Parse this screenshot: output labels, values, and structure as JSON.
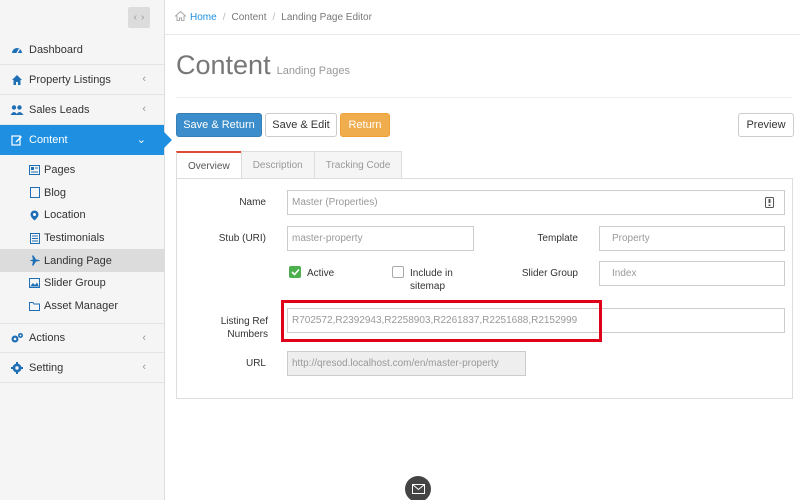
{
  "sidebar": {
    "nav": [
      {
        "label": "Dashboard",
        "icon": "dashboard-icon"
      },
      {
        "label": "Property Listings",
        "icon": "home-icon"
      },
      {
        "label": "Sales Leads",
        "icon": "users-icon"
      },
      {
        "label": "Content",
        "icon": "edit-icon"
      }
    ],
    "content_items": [
      {
        "label": "Pages",
        "icon": "pages-icon"
      },
      {
        "label": "Blog",
        "icon": "blog-icon"
      },
      {
        "label": "Location",
        "icon": "location-pin-icon"
      },
      {
        "label": "Testimonials",
        "icon": "testimonials-icon"
      },
      {
        "label": "Landing Page",
        "icon": "plane-icon"
      },
      {
        "label": "Slider Group",
        "icon": "slider-icon"
      },
      {
        "label": "Asset Manager",
        "icon": "folder-icon"
      }
    ],
    "bottom_nav": [
      {
        "label": "Actions",
        "icon": "cogs-icon"
      },
      {
        "label": "Setting",
        "icon": "gear-icon"
      }
    ]
  },
  "breadcrumb": {
    "home": "Home",
    "section": "Content",
    "page": "Landing Page Editor"
  },
  "page_title": {
    "main": "Content",
    "sub": "Landing Pages"
  },
  "buttons": {
    "save_return": "Save & Return",
    "save_edit": "Save & Edit",
    "return": "Return",
    "preview": "Preview"
  },
  "tabs": [
    "Overview",
    "Description",
    "Tracking Code"
  ],
  "form": {
    "name_label": "Name",
    "name_value": "Master (Properties)",
    "stub_label": "Stub (URI)",
    "stub_value": "master-property",
    "template_label": "Template",
    "template_value": "Property",
    "active_label": "Active",
    "include_sitemap_label": "Include in sitemap",
    "slider_group_label": "Slider Group",
    "slider_group_value": "Index",
    "listing_ref_label": "Listing Ref Numbers",
    "listing_ref_value": "R702572,R2392943,R2258903,R2261837,R2251688,R2152999",
    "url_label": "URL",
    "url_value": "http://qresod.localhost.com/en/master-property"
  },
  "colors": {
    "accent": "#1e8fe1",
    "primary_button": "#3c8dcb",
    "warning_button": "#f0ad4e",
    "highlight": "#e0001a",
    "checkbox_on": "#4cae4c"
  }
}
